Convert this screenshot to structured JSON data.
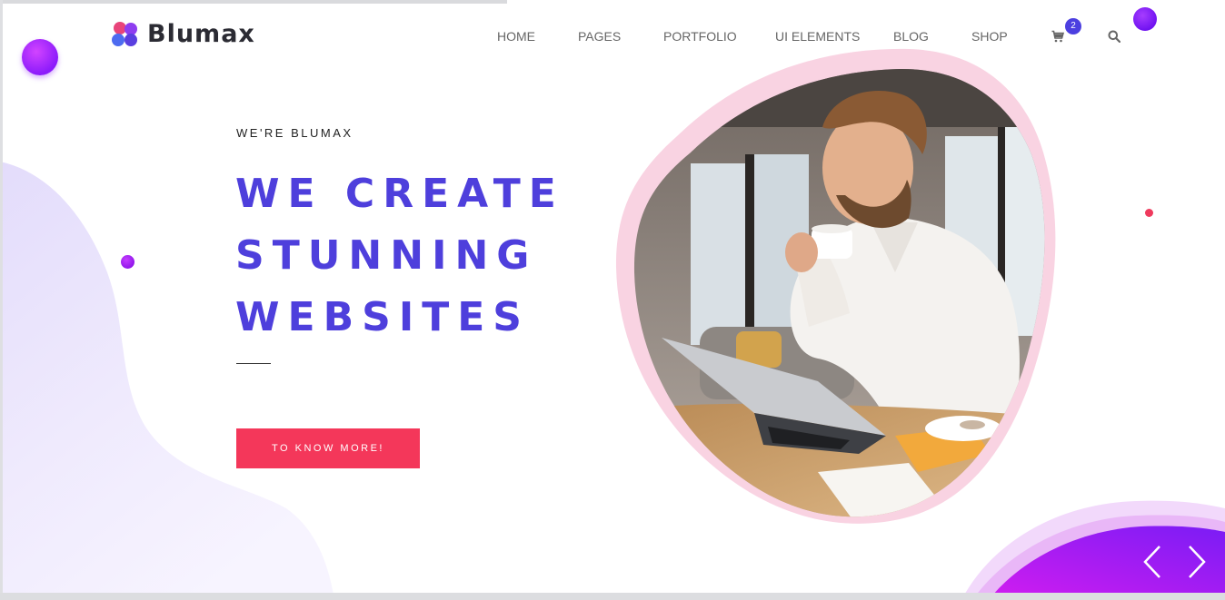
{
  "header": {
    "logo_text": "Blumax",
    "cart_count": "2"
  },
  "nav": {
    "items": [
      "HOME",
      "PAGES",
      "PORTFOLIO",
      "UI ELEMENTS",
      "BLOG",
      "SHOP"
    ]
  },
  "hero": {
    "kicker": "WE'RE BLUMAX",
    "headline": [
      "WE CREATE",
      "STUNNING",
      "WEBSITES"
    ],
    "cta_label": "TO KNOW MORE!"
  },
  "colors": {
    "accent": "#4e3fdc",
    "cta": "#f4375a",
    "purple": "#8c1bfb",
    "pink_ring": "#f9d3e2"
  },
  "icons": {
    "cart": "cart-icon",
    "search": "search-icon",
    "prev": "chevron-left-icon",
    "next": "chevron-right-icon"
  }
}
